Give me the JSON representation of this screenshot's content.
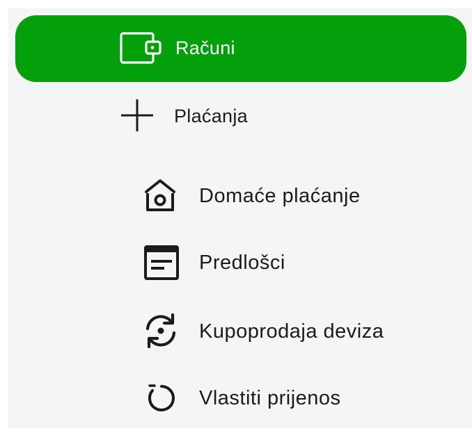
{
  "menu": {
    "accounts": {
      "label": "Računi",
      "icon": "wallet-icon"
    },
    "payments": {
      "label": "Plaćanja",
      "icon": "plus-icon"
    },
    "sub_items": [
      {
        "label": "Domaće plaćanje",
        "icon": "home-payment-icon"
      },
      {
        "label": "Predlošci",
        "icon": "template-icon"
      },
      {
        "label": "Kupoprodaja deviza",
        "icon": "currency-exchange-icon"
      },
      {
        "label": "Vlastiti prijenos",
        "icon": "own-transfer-icon"
      }
    ]
  },
  "colors": {
    "active_bg": "#04a00c",
    "panel_bg": "#f4f5f5",
    "text": "#1b1b1b"
  }
}
